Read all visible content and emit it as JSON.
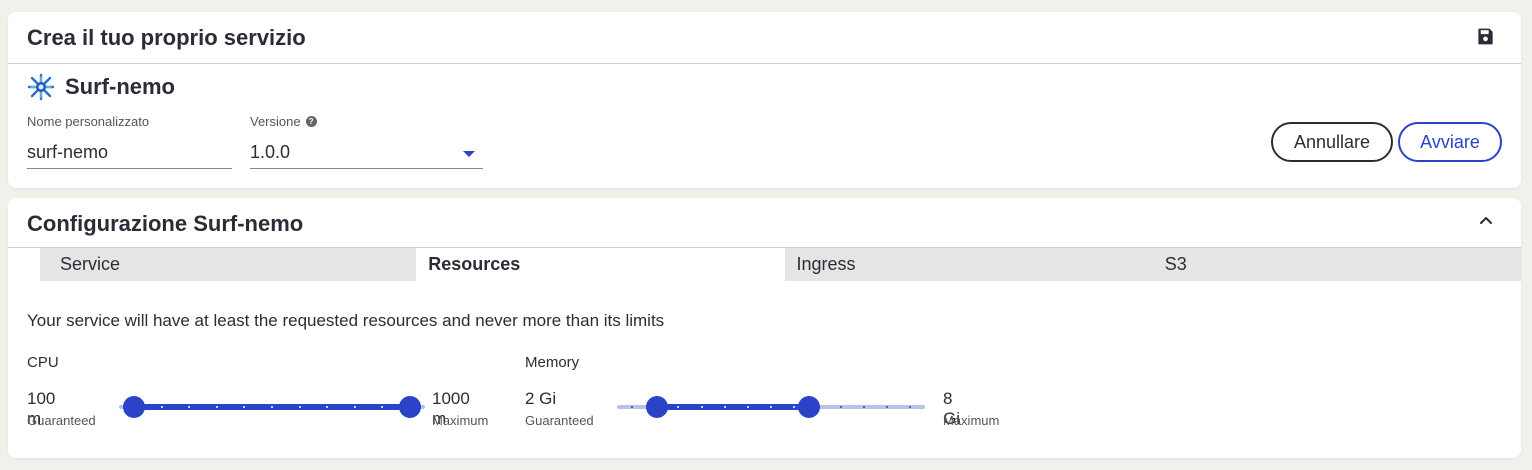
{
  "create_card": {
    "title": "Crea il tuo proprio servizio",
    "save_icon": "save-icon",
    "service_name": "Surf-nemo",
    "service_logo": "surf-nemo-logo",
    "name_field": {
      "label": "Nome personalizzato",
      "value": "surf-nemo"
    },
    "version_field": {
      "label": "Versione",
      "help_icon": "?",
      "value": "1.0.0"
    },
    "cancel_label": "Annullare",
    "start_label": "Avviare"
  },
  "config_card": {
    "title": "Configurazione Surf-nemo",
    "collapse_icon": "chevron-up-icon",
    "tabs": [
      {
        "label": "Service",
        "active": false
      },
      {
        "label": "Resources",
        "active": true
      },
      {
        "label": "Ingress",
        "active": false
      },
      {
        "label": "S3",
        "active": false
      }
    ],
    "description": "Your service will have at least the requested resources and never more than its limits",
    "cpu": {
      "title": "CPU",
      "min_value": "100 m",
      "min_caption": "Guaranteed",
      "max_value": "1000 m",
      "max_caption": "Maximum",
      "range": [
        100,
        1000
      ],
      "steps": 10,
      "selected": [
        100,
        1000
      ]
    },
    "memory": {
      "title": "Memory",
      "min_value": "2 Gi",
      "min_caption": "Guaranteed",
      "max_value": "8 Gi",
      "max_caption": "Maximum",
      "range": [
        1,
        12
      ],
      "steps": 12,
      "selected": [
        2,
        8
      ]
    }
  },
  "colors": {
    "accent": "#2a43c9",
    "accent_light": "#b8c2e8",
    "text": "#2c2c36",
    "background": "#f1f0eb"
  }
}
